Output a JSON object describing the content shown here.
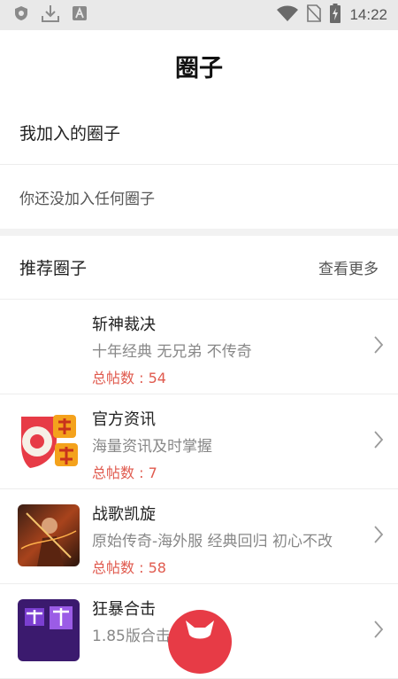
{
  "status_bar": {
    "time": "14:22",
    "icons": [
      "shield-icon",
      "download-icon",
      "a-letter-icon",
      "wifi-icon",
      "no-sim-icon",
      "battery-charging-icon"
    ]
  },
  "header": {
    "title": "圈子"
  },
  "my_circles": {
    "title": "我加入的圈子",
    "empty_text": "你还没加入任何圈子"
  },
  "recommended": {
    "title": "推荐圈子",
    "more_label": "查看更多",
    "items": [
      {
        "name": "斩神裁决",
        "desc": "十年经典 无兄弟 不传奇",
        "count": "总帖数 : 54",
        "thumb": "blank"
      },
      {
        "name": "官方资讯",
        "desc": "海量资讯及时掌握",
        "count": "总帖数 : 7",
        "thumb": "official-news-logo"
      },
      {
        "name": "战歌凯旋",
        "desc": "原始传奇-海外服 经典回归 初心不改",
        "count": "总帖数 : 58",
        "thumb": "warrior-game-art"
      },
      {
        "name": "狂暴合击",
        "desc": "1.85版合击",
        "count": "",
        "thumb": "purple-game-art"
      }
    ]
  },
  "colors": {
    "accent": "#e73b46",
    "count_red": "#e05a4e",
    "statusbar_bg": "#e9e9e9"
  }
}
